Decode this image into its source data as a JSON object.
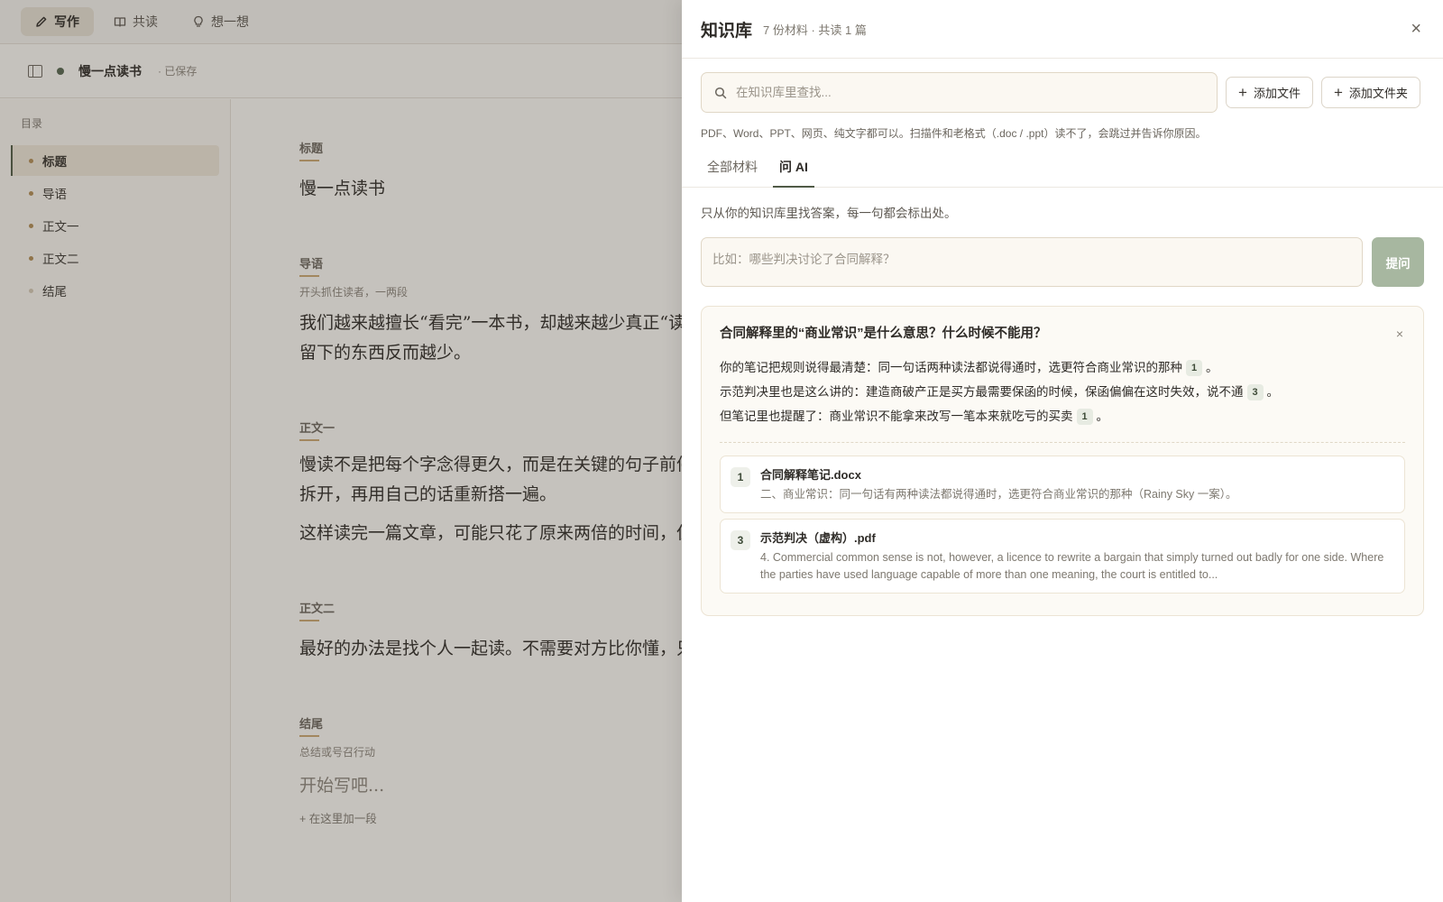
{
  "topbar": {
    "tabs": [
      {
        "label": "写作",
        "icon": "pencil-icon"
      },
      {
        "label": "共读",
        "icon": "book-icon"
      },
      {
        "label": "想一想",
        "icon": "lightbulb-icon"
      }
    ]
  },
  "doc": {
    "title": "慢一点读书",
    "saved_status": "· 已保存"
  },
  "toc": {
    "heading": "目录",
    "items": [
      {
        "label": "标题"
      },
      {
        "label": "导语"
      },
      {
        "label": "正文一"
      },
      {
        "label": "正文二"
      },
      {
        "label": "结尾"
      }
    ]
  },
  "editor": {
    "title_section": {
      "label": "标题",
      "text": "慢一点读书"
    },
    "intro_section": {
      "label": "导语",
      "hint": "开头抓住读者，一两段",
      "line1": "我们越来越擅长“看完”一本书，却越来越少真正“读进去”",
      "line2": "留下的东西反而越少。"
    },
    "body1_section": {
      "label": "正文一",
      "p1_line1": "慢读不是把每个字念得更久，而是在关键的句子前停下来",
      "p1_line2": "拆开，再用自己的话重新搭一遍。",
      "p2": "这样读完一篇文章，可能只花了原来两倍的时间，但是"
    },
    "body2_section": {
      "label": "正文二",
      "p1": "最好的办法是找个人一起读。不需要对方比你懂，只需要"
    },
    "ending_section": {
      "label": "结尾",
      "hint": "总结或号召行动",
      "placeholder": "开始写吧...",
      "add_para": "+ 在这里加一段"
    }
  },
  "panel": {
    "title": "知识库",
    "subtitle": "7 份材料 · 共读 1 篇",
    "search": {
      "placeholder": "在知识库里查找..."
    },
    "add_file_label": "添加文件",
    "add_folder_label": "添加文件夹",
    "hint": "PDF、Word、PPT、网页、纯文字都可以。扫描件和老格式（.doc / .ppt）读不了，会跳过并告诉你原因。",
    "tabs": [
      {
        "label": "全部材料"
      },
      {
        "label": "问 AI"
      }
    ],
    "ai": {
      "description": "只从你的知识库里找答案，每一句都会标出处。",
      "ask_placeholder": "比如：哪些判决讨论了合同解释？",
      "ask_button": "提问",
      "answer": {
        "question": "合同解释里的“商业常识”是什么意思？什么时候不能用？",
        "close": "×",
        "lines": [
          {
            "text": "你的笔记把规则说得最清楚：同一句话两种读法都说得通时，选更符合商业常识的那种",
            "cite": "1",
            "end": "。"
          },
          {
            "text": "示范判决里也是这么讲的：建造商破产正是买方最需要保函的时候，保函偏偏在这时失效，说不通",
            "cite": "3",
            "end": "。"
          },
          {
            "text": "但笔记里也提醒了：商业常识不能拿来改写一笔本来就吃亏的买卖",
            "cite": "1",
            "end": "。"
          }
        ],
        "sources": [
          {
            "num": "1",
            "file": "合同解释笔记.docx",
            "excerpt": "二、商业常识：同一句话有两种读法都说得通时，选更符合商业常识的那种（Rainy Sky 一案）。"
          },
          {
            "num": "3",
            "file": "示范判决（虚构）.pdf",
            "excerpt": "4. Commercial common sense is not, however, a licence to rewrite a bargain that simply turned out badly for one side. Where the parties have used language capable of more than one meaning, the court is entitled to..."
          }
        ]
      }
    },
    "close": "×"
  },
  "colors": {
    "accent": "#4f5a46",
    "gold": "#b08c55",
    "ask_button": "#a7b7a0"
  }
}
